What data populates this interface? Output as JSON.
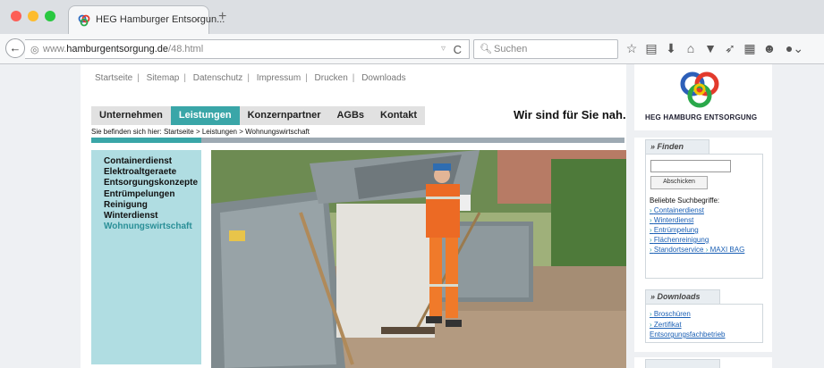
{
  "browser": {
    "tab_title": "HEG Hamburger Entsorgun...",
    "tab_close": "×",
    "new_tab": "+",
    "url_prefix": "www.",
    "url_domain": "hamburgentsorgung.de",
    "url_path": "/48.html",
    "search_placeholder": "Suchen",
    "icons": [
      "star-icon",
      "reader-icon",
      "download-icon",
      "home-icon",
      "pocket-icon",
      "send-icon",
      "grid-icon",
      "chat-icon",
      "user-icon"
    ]
  },
  "topnav": [
    "Startseite",
    "Sitemap",
    "Datenschutz",
    "Impressum",
    "Drucken",
    "Downloads"
  ],
  "topnav_sep": "|",
  "menu": [
    "Unternehmen",
    "Leistungen",
    "Konzernpartner",
    "AGBs",
    "Kontakt"
  ],
  "menu_active": "Leistungen",
  "slogan": "Wir sind für Sie nah.",
  "breadcrumb": "Sie befinden sich hier: Startseite > Leistungen > Wohnungswirtschaft",
  "submenu": [
    "Containerdienst",
    "Elektroaltgeraete",
    "Entsorgungskonzepte",
    "Entrümpelungen",
    "Reinigung",
    "Winterdienst",
    "Wohnungswirtschaft"
  ],
  "submenu_current": "Wohnungswirtschaft",
  "logo_text": "HEG HAMBURG ENTSORGUNG",
  "find": {
    "title": "» Finden",
    "button": "Abschicken",
    "popular_label": "Beliebte Suchbegriffe:",
    "links": [
      "Containerdienst",
      "Winterdienst",
      "Entrümpelung",
      "Flächenreinigung",
      "Standortservice",
      "MAXI BAG"
    ]
  },
  "downloads": {
    "title": "» Downloads",
    "links": [
      "Broschüren",
      "Zertifikat Entsorgungsfachbetrieb"
    ]
  },
  "colors": {
    "accent": "#3aa6a8",
    "submenu_bg": "#b0dde2"
  }
}
